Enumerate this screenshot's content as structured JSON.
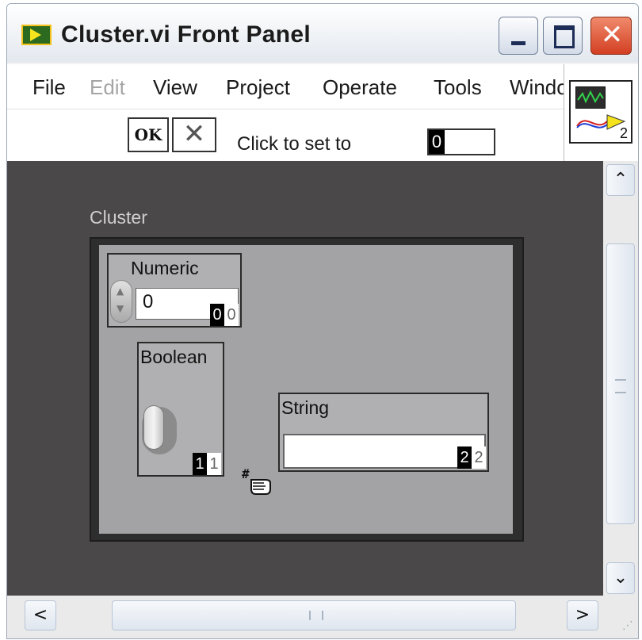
{
  "window": {
    "title": "Cluster.vi Front Panel",
    "minimize_icon": "minimize-icon",
    "maximize_icon": "maximize-icon",
    "close_glyph": "✕"
  },
  "menu": {
    "items": [
      "File",
      "Edit",
      "View",
      "Project",
      "Operate",
      "Tools",
      "Window"
    ],
    "disabled": [
      "Edit"
    ]
  },
  "toolbar": {
    "ok_label": "OK",
    "cancel_glyph": "✕",
    "hint": "Click to set to",
    "set_to_value": "0"
  },
  "vi_icon": {
    "connector_number": "2"
  },
  "cluster": {
    "label": "Cluster",
    "numeric": {
      "label": "Numeric",
      "value": "0",
      "order_current": "0",
      "order_old": "0"
    },
    "boolean": {
      "label": "Boolean",
      "order_current": "1",
      "order_old": "1"
    },
    "string": {
      "label": "String",
      "value": "",
      "order_current": "2",
      "order_old": "2"
    }
  },
  "scrollbars": {
    "up": "⌃",
    "down": "⌄",
    "left": "<",
    "right": ">"
  },
  "colors": {
    "panel_background": "#4b484a",
    "cluster_fill": "#a3a3a5",
    "close_button": "#d33f22"
  }
}
